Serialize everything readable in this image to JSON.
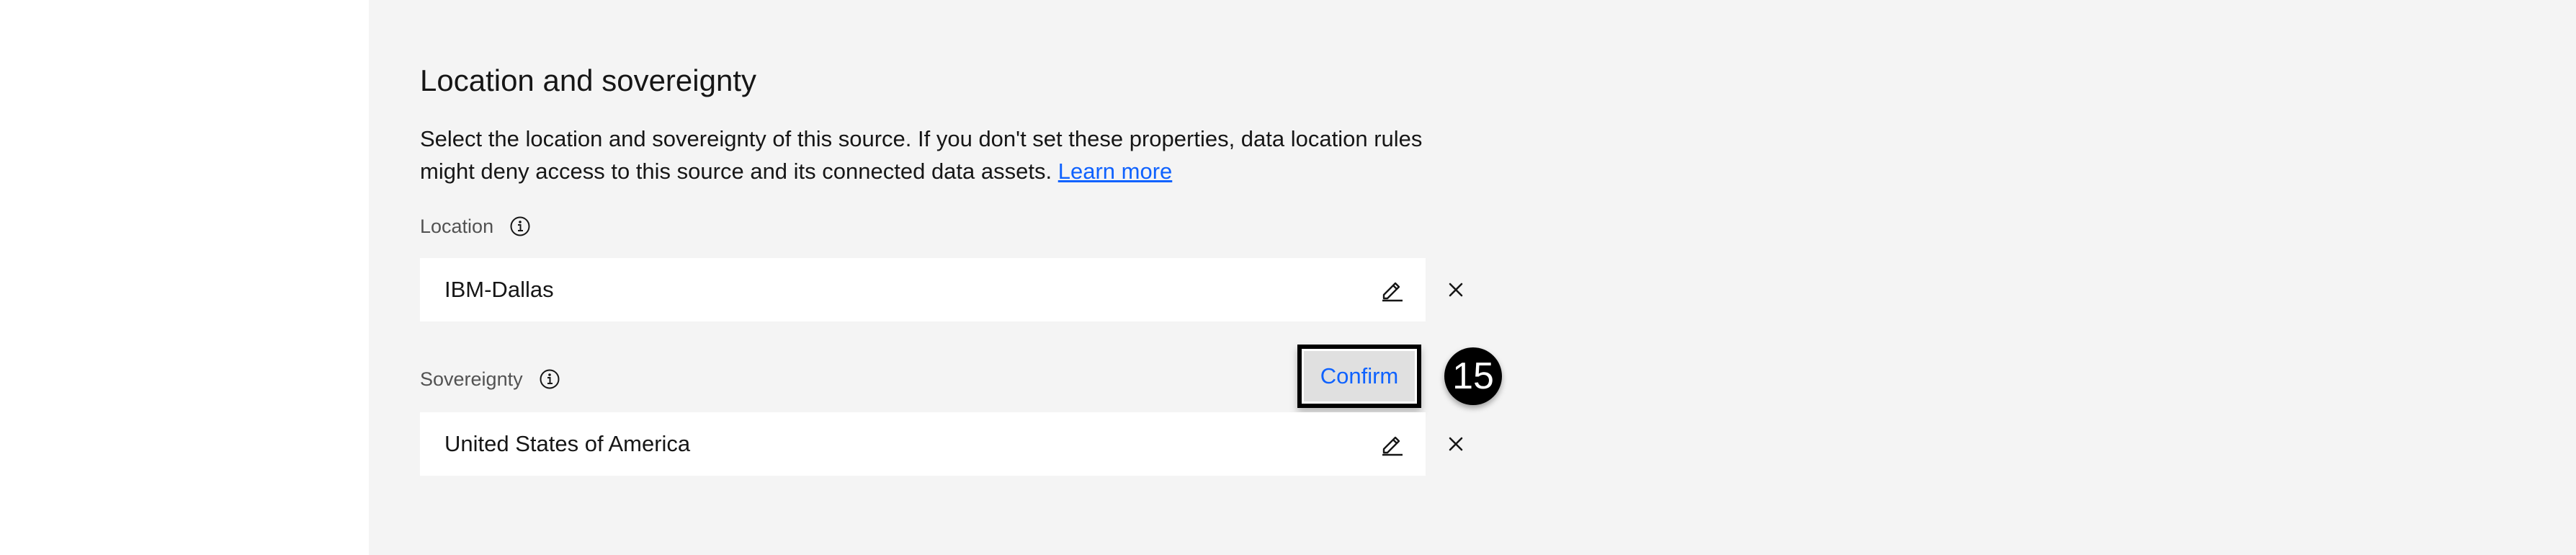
{
  "section": {
    "title": "Location and sovereignty",
    "description": "Select the location and sovereignty of this source. If you don't set these properties, data location rules might deny access to this source and its connected data assets.",
    "learn_more": "Learn more"
  },
  "location": {
    "label": "Location",
    "value": "IBM-Dallas",
    "info_icon": "information-icon",
    "edit_icon": "pencil-icon",
    "clear_icon": "close-icon"
  },
  "sovereignty": {
    "label": "Sovereignty",
    "value": "United States of America",
    "info_icon": "information-icon",
    "edit_icon": "pencil-icon",
    "clear_icon": "close-icon"
  },
  "confirm": {
    "label": "Confirm"
  },
  "annotation": {
    "step": "15"
  },
  "colors": {
    "background": "#f4f4f4",
    "field_background": "#ffffff",
    "link": "#0f62fe",
    "text": "#161616",
    "label": "#525252"
  }
}
